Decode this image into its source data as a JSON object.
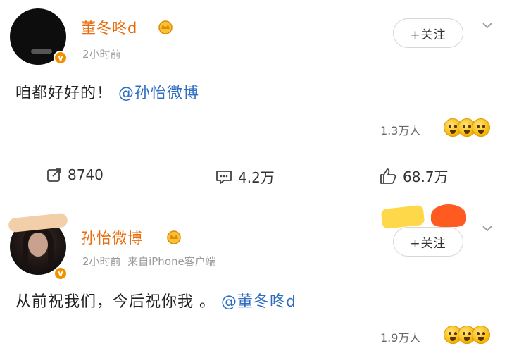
{
  "posts": [
    {
      "username": "董冬咚d",
      "time": "2小时前",
      "source": "",
      "follow_label": "+关注",
      "content_text": "咱都好好的！",
      "mention": "@孙怡微博",
      "likes": "1.3万人",
      "actions": {
        "repost": "8740",
        "comment": "4.2万",
        "like": "68.7万"
      }
    },
    {
      "username": "孙怡微博",
      "time": "2小时前",
      "source": "来自iPhone客户端",
      "follow_label": "+关注",
      "content_text": "从前祝我们，今后祝你我 。",
      "mention": "@董冬咚d",
      "likes": "1.9万人"
    }
  ],
  "colors": {
    "username": "#e86b0c",
    "mention": "#2e6dbf",
    "verified_badge": "#f29100"
  },
  "icons": [
    "crown-icon",
    "verified-badge-icon",
    "chevron-down-icon",
    "repost-icon",
    "comment-icon",
    "like-icon",
    "emoji-icon"
  ]
}
